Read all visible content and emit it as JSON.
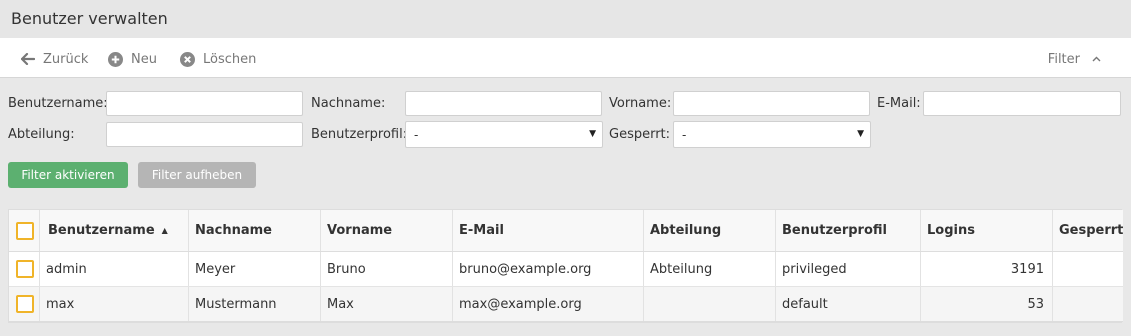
{
  "page": {
    "title": "Benutzer verwalten"
  },
  "toolbar": {
    "back_label": "Zurück",
    "new_label": "Neu",
    "delete_label": "Löschen",
    "filter_label": "Filter"
  },
  "filter": {
    "username_label": "Benutzername:",
    "lastname_label": "Nachname:",
    "firstname_label": "Vorname:",
    "email_label": "E-Mail:",
    "department_label": "Abteilung:",
    "profile_label": "Benutzerprofil:",
    "profile_value": "-",
    "locked_label": "Gesperrt:",
    "locked_value": "-",
    "username_value": "",
    "lastname_value": "",
    "firstname_value": "",
    "email_value": "",
    "department_value": "",
    "apply_label": "Filter aktivieren",
    "clear_label": "Filter aufheben"
  },
  "table": {
    "columns": [
      "Benutzername",
      "Nachname",
      "Vorname",
      "E-Mail",
      "Abteilung",
      "Benutzerprofil",
      "Logins",
      "Gesperrt"
    ],
    "sort_indicator": "▲",
    "rows": [
      [
        "admin",
        "Meyer",
        "Bruno",
        "bruno@example.org",
        "Abteilung",
        "privileged",
        "3191",
        ""
      ],
      [
        "max",
        "Mustermann",
        "Max",
        "max@example.org",
        "",
        "default",
        "53",
        ""
      ]
    ]
  },
  "colors": {
    "accent_green": "#5cb070",
    "checkbox_border": "#f0b429",
    "disabled_gray": "#b5b5b5"
  }
}
